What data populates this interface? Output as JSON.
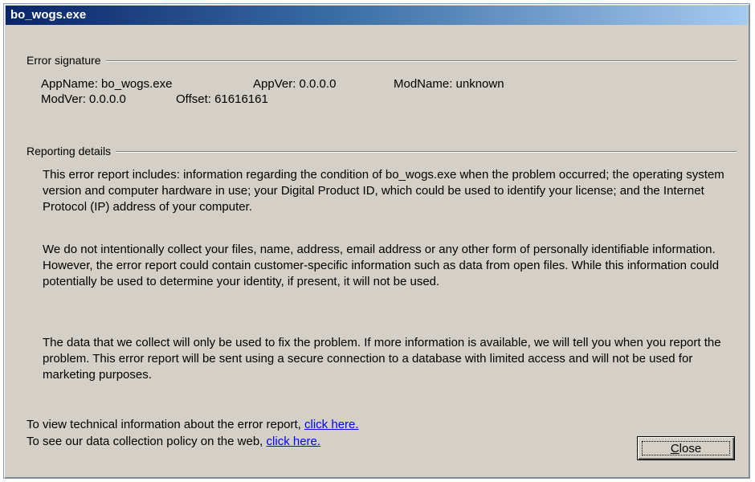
{
  "window": {
    "title": "bo_wogs.exe"
  },
  "error_signature": {
    "heading": "Error signature",
    "app_name": "AppName: bo_wogs.exe",
    "app_ver": "AppVer: 0.0.0.0",
    "mod_name": "ModName: unknown",
    "mod_ver": "ModVer: 0.0.0.0",
    "offset": "Offset: 61616161"
  },
  "reporting_details": {
    "heading": "Reporting details",
    "paragraphs": [
      "This error report includes: information regarding the condition of bo_wogs.exe when the problem occurred; the operating system version and computer hardware in use; your Digital Product ID, which could be used to identify your license; and the Internet Protocol (IP) address of your computer.",
      "We do not intentionally collect your files, name, address, email address or any other form of personally identifiable information. However, the error report could contain customer-specific information such as data from open files. While this information could potentially be used to determine your identity, if present, it will not be used.",
      "The data that we collect will only be used to fix the problem. If more information is available, we will tell you when you report the problem. This error report will be sent using a secure connection to a database with limited access and will not be used for marketing purposes."
    ]
  },
  "footer": {
    "tech_info_text": "To view technical information about the error report,",
    "tech_info_link": "click here.",
    "policy_text": "To see our data collection policy on the web,",
    "policy_link": "click here."
  },
  "buttons": {
    "close_first_letter": "C",
    "close_rest": "lose"
  },
  "colors": {
    "dialog_bg": "#d4d0c8",
    "title_start": "#0a246a",
    "title_end": "#a6caf0",
    "link": "#0000ff"
  }
}
